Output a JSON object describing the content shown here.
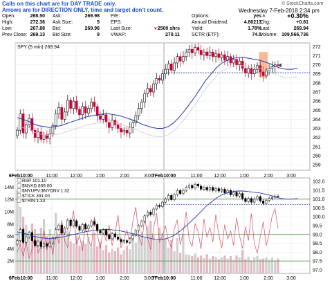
{
  "notice": {
    "line1": "Calls on this chart are for DAY TRADE only.",
    "line2": "Arrows are for DIRECTION ONLY, time and target don't count."
  },
  "timestamp": "Wednesday  7-Feb-2018  2:34 pm",
  "watermark": "© StockCharts.com",
  "quote": {
    "open": {
      "label": "Open:",
      "value": "268.50"
    },
    "high": {
      "label": "High:",
      "value": "272.36"
    },
    "low": {
      "label": "Low:",
      "value": "267.88"
    },
    "prev_close": {
      "label": "Prev Close:",
      "value": "269.13"
    },
    "ask": {
      "label": "Ask:",
      "value": "269.98"
    },
    "ask_size": {
      "label": "Ask Size:",
      "value": "5"
    },
    "bid": {
      "label": "Bid:",
      "value": "269.96"
    },
    "bid_size": {
      "label": "Bid Size:",
      "value": "9"
    },
    "pe": {
      "label": "P/E:",
      "value": ""
    },
    "eps": {
      "label": "EPS:",
      "value": ""
    },
    "last_size": {
      "label": "Last Size:",
      "value": "2500 shrs"
    },
    "vwap": {
      "label": "VWAP:",
      "value": "270.11"
    },
    "options": {
      "label": "Options:",
      "value": "yes"
    },
    "annual_dividend": {
      "label": "Annual Dividend:",
      "value": "4.80213"
    },
    "yield": {
      "label": "Yield:",
      "value": "1.78%"
    },
    "sctr": {
      "label": "SCTR (ETF):",
      "value": "74.5"
    },
    "pct_change": "+0.30%",
    "chg": {
      "label": "Chg:",
      "value": "+0.81"
    },
    "last": {
      "label": "Last:",
      "value": "269.94"
    },
    "volume": {
      "label": "Volume:",
      "value": "109,566,736"
    }
  },
  "colors": {
    "up": "#000000",
    "down": "#cc0033",
    "ma": "#2233aa",
    "vwap": "#8888aa",
    "highlight": "#f4b183",
    "green_line": "#3a8a3a",
    "ratio": "#d0304a",
    "blue_text": "#1a4fd1",
    "volume_bar": "#cfcfcf"
  },
  "chart_data": [
    {
      "type": "candlestick",
      "title": "SPY (5 min) 269.94",
      "x_tick_labels": [
        "6Feb10:00",
        "11:00",
        "12:00",
        "1:00",
        "2:00",
        "3:00",
        "7Feb10:00",
        "11:00",
        "12:00",
        "1:00",
        "2:00",
        "3:00"
      ],
      "y_tick_labels": [
        "259",
        "260",
        "261",
        "262",
        "263",
        "264",
        "265",
        "266",
        "267",
        "268",
        "269",
        "270",
        "271",
        "272"
      ],
      "ylim": [
        258.4,
        272.4
      ],
      "reference_line": 269.13,
      "last_price": 269.94,
      "close": [
        262.8,
        264.6,
        262.5,
        263.4,
        264.1,
        262.8,
        262.0,
        262.6,
        261.8,
        262.3,
        261.9,
        262.4,
        263.3,
        264.6,
        265.3,
        264.0,
        264.8,
        266.1,
        265.2,
        266.0,
        265.1,
        264.5,
        265.4,
        264.7,
        265.2,
        265.9,
        265.4,
        264.4,
        264.0,
        264.5,
        263.7,
        263.1,
        263.9,
        263.4,
        263.0,
        262.6,
        262.8,
        262.5,
        263.1,
        263.6,
        264.4,
        265.2,
        265.9,
        266.8,
        267.4,
        267.0,
        267.9,
        268.5,
        268.3,
        269.0,
        269.5,
        270.1,
        269.4,
        270.2,
        270.9,
        270.4,
        270.9,
        271.4,
        271.7,
        271.3,
        271.9,
        271.6,
        271.1,
        271.4,
        271.0,
        271.4,
        270.9,
        271.2,
        270.8,
        271.1,
        270.5,
        270.9,
        270.2,
        270.6,
        270.0,
        270.4,
        269.6,
        269.1,
        269.6,
        269.0,
        269.5,
        269.9,
        269.2,
        268.8,
        269.3,
        269.6,
        269.8,
        270.0,
        269.94
      ],
      "blue_ma_approx": [
        264.2,
        264.0,
        263.8,
        263.5,
        263.3,
        263.2,
        263.1,
        263.2,
        263.3,
        263.5,
        263.7,
        263.9,
        264.1,
        264.3,
        264.4,
        264.5,
        264.6,
        264.6,
        264.5,
        264.4,
        264.2,
        264.0,
        263.8,
        263.5,
        263.3,
        263.1,
        263.0,
        263.0,
        263.2,
        263.6,
        264.2,
        264.9,
        265.7,
        266.5,
        267.4,
        268.3,
        269.0,
        269.7,
        270.2,
        270.5,
        270.7,
        270.8,
        270.8,
        270.7,
        270.6,
        270.5,
        270.3,
        270.1,
        269.8,
        269.6,
        269.5,
        269.5,
        269.6
      ],
      "highlight_bars": {
        "from": 82,
        "to": 84
      }
    },
    {
      "type": "line",
      "series_labels": [
        "RSP 101.10",
        "$NYAD 809.00",
        "$NYUPV:$NYDNV 1.32",
        "$TICK 391.00",
        "$TRIN 1.33"
      ],
      "y_tick_labels": [
        "97.0",
        "97.5",
        "98.0",
        "98.5",
        "99.0",
        "99.5",
        "100.0",
        "100.5",
        "101.0",
        "101.5",
        "102.0"
      ],
      "left_tick_labels": [
        "2M",
        "4M",
        "6M",
        "8M",
        "10M",
        "12M",
        "14M"
      ],
      "x_tick_labels": [
        "6Feb10:00",
        "11:00",
        "12:00",
        "1:00",
        "2:00",
        "3:00",
        "7Feb10:00",
        "11:00",
        "12:00",
        "1:00",
        "2:00",
        "3:00"
      ],
      "ylim": [
        96.8,
        102.2
      ],
      "volume_millions": [
        13.5,
        10.8,
        9.2,
        7.9,
        6.8,
        8.1,
        7.2,
        6.5,
        7.4,
        8.8,
        6.1,
        7.2,
        5.4,
        9.8,
        6.2,
        7.1,
        5.8,
        6.9,
        5.2,
        4.9,
        6.1,
        4.5,
        5.3,
        4.8,
        5.9,
        4.2,
        6.6,
        4.4,
        5.1,
        3.8,
        4.6,
        3.4,
        4.0,
        3.6,
        4.2,
        3.1,
        3.8,
        4.5,
        3.9,
        5.8,
        5.0,
        6.2,
        6.8,
        5.9,
        7.6,
        8.5,
        6.2,
        5.4,
        7.4,
        6.5,
        5.6,
        4.2,
        5.4,
        3.6,
        5.7,
        3.3,
        6.4,
        3.1,
        3.0,
        2.8,
        3.2,
        2.6,
        2.9,
        2.5,
        3.1,
        2.4,
        2.8,
        2.7,
        2.3,
        2.6,
        2.9,
        2.4,
        2.8,
        2.2,
        2.9,
        2.6,
        3.8,
        2.3,
        2.7,
        2.1,
        2.6,
        2.8,
        2.3,
        2.4,
        2.6,
        2.2,
        2.5,
        2.1,
        2.4
      ],
      "ratio_series": [
        2.0,
        3.5,
        1.2,
        4.0,
        0.8,
        2.6,
        5.2,
        1.9,
        3.0,
        6.1,
        2.4,
        4.8,
        1.5,
        5.8,
        3.7,
        8.0,
        4.2,
        2.9,
        6.9,
        9.8,
        3.5,
        5.1,
        2.2,
        7.6,
        4.3,
        3.0,
        8.6,
        5.4,
        2.7,
        6.3,
        4.0,
        7.1,
        3.2,
        5.6,
        9.0,
        2.8,
        4.4,
        6.2,
        3.6,
        7.8,
        10.5,
        5.0,
        3.3,
        8.9,
        4.6,
        2.5,
        6.6,
        9.4,
        3.8,
        5.2,
        7.0,
        4.1,
        2.9,
        6.4,
        8.1,
        3.4,
        5.7,
        9.6,
        4.3,
        3.1,
        7.4,
        5.9,
        2.6,
        8.3,
        4.8,
        6.7,
        3.9,
        9.1,
        5.3,
        2.8,
        7.2,
        4.5,
        6.0,
        3.3,
        8.5,
        5.1,
        2.7,
        6.8,
        4.2,
        9.3,
        3.6,
        1.8,
        4.9,
        7.7,
        3.2,
        5.5,
        8.8,
        10.2,
        6.4
      ]
    }
  ]
}
